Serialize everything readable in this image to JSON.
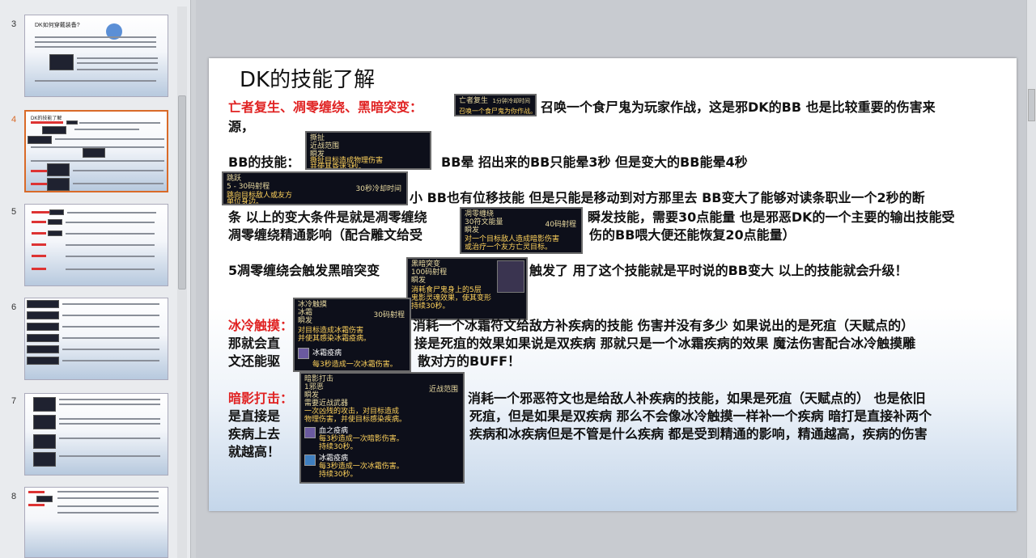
{
  "thumbnails": [
    {
      "num": "3",
      "title": "DK如何穿戴装备?",
      "badge": "BB"
    },
    {
      "num": "4",
      "title": "DK的技能了解"
    },
    {
      "num": "5"
    },
    {
      "num": "6"
    },
    {
      "num": "7"
    },
    {
      "num": "8"
    }
  ],
  "slide": {
    "title": "DK的技能了解",
    "line1_red": "亡者复生、凋零缠绕、黑暗突变：",
    "line1_text": "召唤一个食尸鬼为玩家作战，这是邪DK的BB 也是比较重要的伤害来",
    "line1b_text": "源，",
    "bb_label": "BB的技能：",
    "bb_text": "BB晕 招出来的BB只能晕3秒 但是变大的BB能晕4秒",
    "l3_text": "小 BB也有位移技能 但是只能是移动到对方那里去 BB变大了能够对读条职业一个2秒的断",
    "l4a_text": "条 以上的变大条件是就是凋零缠绕",
    "l4b_text": "瞬发技能，需要30点能量 也是邪恶DK的一个主要的输出技能受",
    "l5a_text": "凋零缠绕精通影响（配合雕文给受",
    "l5b_text": "伤的BB喂大便还能恢复20点能量）",
    "l6a_text": "5凋零缠绕会触发黑暗突变",
    "l6b_text": "触发了 用了这个技能就是平时说的BB变大 以上的技能就会升级！",
    "frost_red": "冰冷触摸：",
    "frost_1": "消耗一个冰霜符文给敌方补疾病的技能 伤害并没有多少 如果说出的是死疽（天赋点的）",
    "frost_2a": "那就会直",
    "frost_2b": "接是死疽的效果如果说是双疾病 那就只是一个冰霜疾病的效果 魔法伤害配合冰冷触摸雕",
    "frost_3a": "文还能驱",
    "frost_3b": "散对方的BUFF！",
    "shadow_red": "暗影打击：",
    "shadow_1": "消耗一个邪恶符文也是给敌人补疾病的技能，如果是死疽（天赋点的） 也是依旧",
    "shadow_2a": "是直接是",
    "shadow_2b": "死疽，但是如果是双疾病 那么不会像冰冷触摸一样补一个疾病 暗打是直接补两个",
    "shadow_3a": "疾病上去",
    "shadow_3b": "疾病和冰疾病但是不管是什么疾病 都是受到精通的影响，精通越高，疾病的伤害",
    "shadow_4": "就越高！"
  },
  "tooltips": {
    "t1": {
      "title": "亡者复生",
      "right": "1分钟冷却时间",
      "l2": "召唤一个食尸鬼为你作战。"
    },
    "t2": {
      "title": "撕扯",
      "l2": "近战范围",
      "l3": "瞬发",
      "l4": "撕扯目标造成物理伤害",
      "l5": "并使其昏迷3秒。"
    },
    "t3": {
      "title": "跳跃",
      "l2": "5 - 30码射程",
      "right": "30秒冷却时间",
      "l3": "跳向目标敌人或友方",
      "l4": "单位身边。"
    },
    "t4": {
      "title": "凋零缠绕",
      "l2": "30符文能量",
      "right": "40码射程",
      "l3": "瞬发",
      "l4": "对一个目标敌人造成暗影伤害",
      "l5": "或治疗一个友方亡灵目标。"
    },
    "t5": {
      "title": "黑暗突变",
      "l2": "100码射程",
      "l3": "瞬发",
      "l4": "消耗食尸鬼身上的5层",
      "l5": "鬼影灵魂效果，使其变形",
      "l6": "持续30秒。"
    },
    "t6": {
      "title": "冰冷触摸",
      "l2": "冰霜",
      "right": "30码射程",
      "l3": "瞬发",
      "l4": "对目标造成冰霜伤害",
      "l5": "并使其感染冰霜疫病。",
      "l6": "冰霜疫病",
      "l7": "每3秒造成一次冰霜伤害。"
    },
    "t7": {
      "title": "暗影打击",
      "l2": "1邪恶",
      "right": "近战范围",
      "l3": "瞬发",
      "l4": "需要近战武器",
      "l5": "一次凶残的攻击，对目标造成",
      "l6": "物理伤害，并使目标感染疾病。",
      "l7": "血之疫病",
      "l8": "每3秒造成一次暗影伤害。",
      "l9": "持续30秒。",
      "l10": "冰霜疫病",
      "l11": "每3秒造成一次冰霜伤害。",
      "l12": "持续30秒。"
    }
  }
}
